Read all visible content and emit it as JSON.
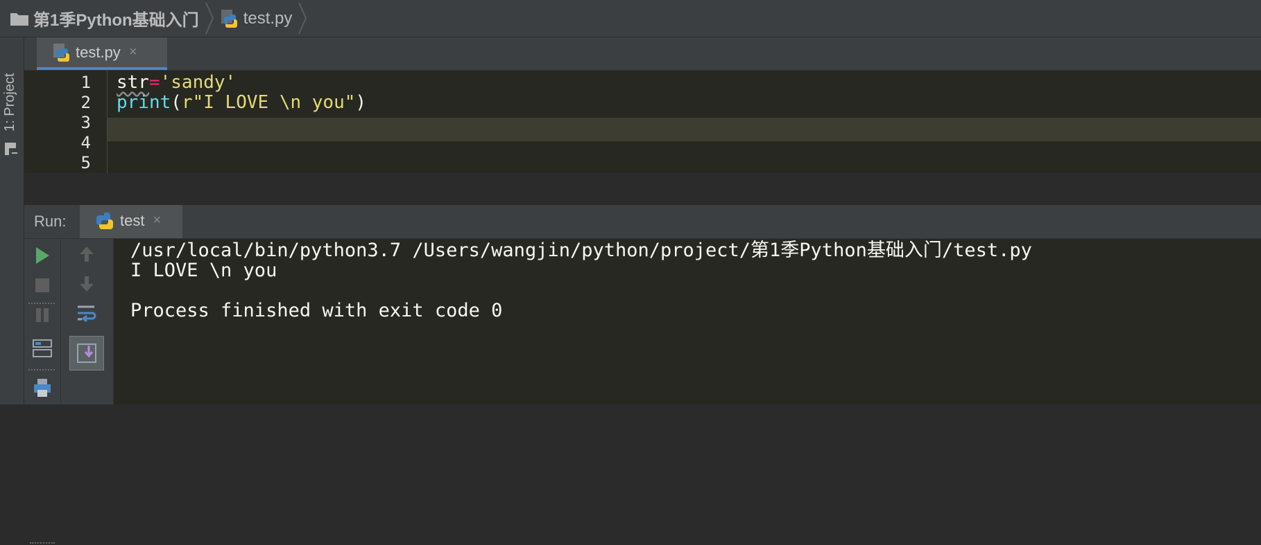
{
  "breadcrumb": {
    "project": "第1季Python基础入门",
    "file": "test.py",
    "icons": [
      "folder-icon",
      "python-file-icon"
    ]
  },
  "tool_window": {
    "project_tab_label": "1: Project"
  },
  "editor": {
    "tab_label": "test.py",
    "tab_close": "×",
    "line_numbers": [
      "1",
      "2",
      "3",
      "4",
      "5"
    ],
    "lines": {
      "l1": {
        "ident": "str",
        "op": "=",
        "str": "'sandy'"
      },
      "l2": {
        "builtin": "print",
        "open": "(",
        "str": "r\"I LOVE \\n you\"",
        "close": ")"
      }
    },
    "current_line": 3,
    "colors": {
      "background": "#272822",
      "keyword_op": "#f92672",
      "string": "#e6db74",
      "builtin": "#66d9ef",
      "current_line_bg": "#3e3d32"
    }
  },
  "run_panel": {
    "title": "Run:",
    "tab_label": "test",
    "tab_close": "×",
    "toolbar": [
      "run-icon",
      "stop-icon",
      "pause-icon",
      "layout-icon",
      "print-icon",
      "up-arrow-icon",
      "down-arrow-icon",
      "soft-wrap-icon",
      "scroll-to-end-icon"
    ],
    "console": [
      "/usr/local/bin/python3.7 /Users/wangjin/python/project/第1季Python基础入门/test.py",
      "I LOVE \\n you",
      "",
      "Process finished with exit code 0"
    ]
  }
}
